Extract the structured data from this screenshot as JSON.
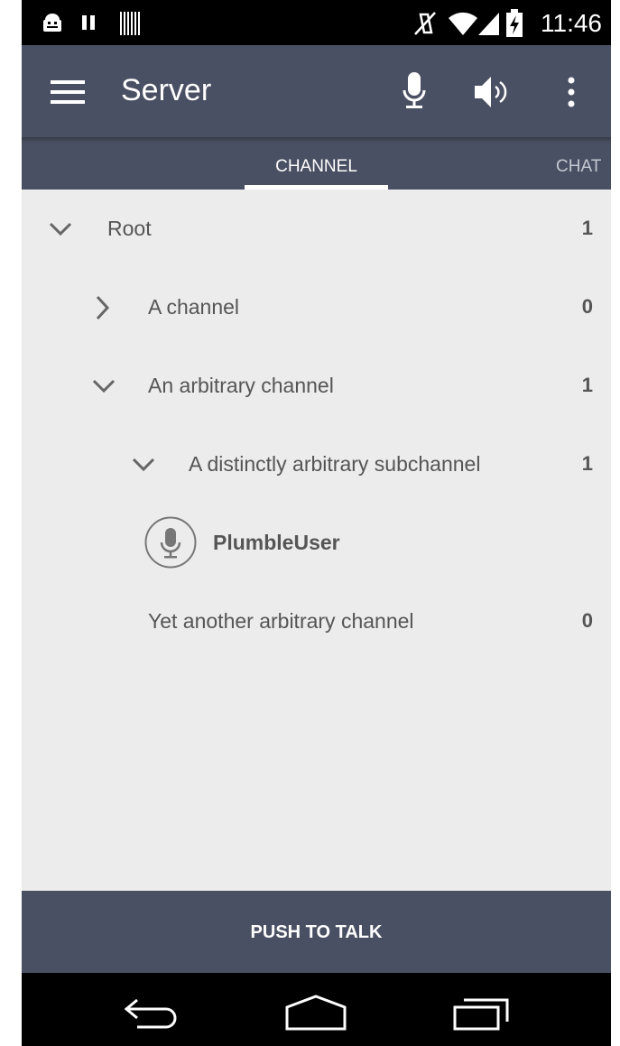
{
  "status_bar": {
    "time": "11:46"
  },
  "action_bar": {
    "title": "Server",
    "menu_icon": "hamburger-menu-icon",
    "mic_icon": "microphone-icon",
    "speaker_icon": "speaker-icon",
    "overflow_icon": "overflow-menu-icon"
  },
  "tabs": [
    {
      "label": "CHANNEL",
      "selected": true
    },
    {
      "label": "CHAT",
      "selected": false
    }
  ],
  "channels": [
    {
      "name": "Root",
      "count": "1",
      "expanded": true,
      "level": 0
    },
    {
      "name": "A channel",
      "count": "0",
      "expanded": false,
      "level": 1
    },
    {
      "name": "An arbitrary channel",
      "count": "1",
      "expanded": true,
      "level": 1
    },
    {
      "name": "A distinctly arbitrary subchannel",
      "count": "1",
      "expanded": true,
      "level": 2
    },
    {
      "name": "PlumbleUser",
      "type": "user",
      "icon": "user-microphone-icon"
    },
    {
      "name": "Yet another arbitrary channel",
      "count": "0",
      "level": 1
    }
  ],
  "push_to_talk": {
    "label": "PUSH TO TALK"
  },
  "nav_bar": {
    "back_icon": "back-icon",
    "home_icon": "home-icon",
    "recents_icon": "recents-icon"
  },
  "colors": {
    "primary": "#4a5063",
    "background": "#ececec",
    "text": "#555555"
  }
}
